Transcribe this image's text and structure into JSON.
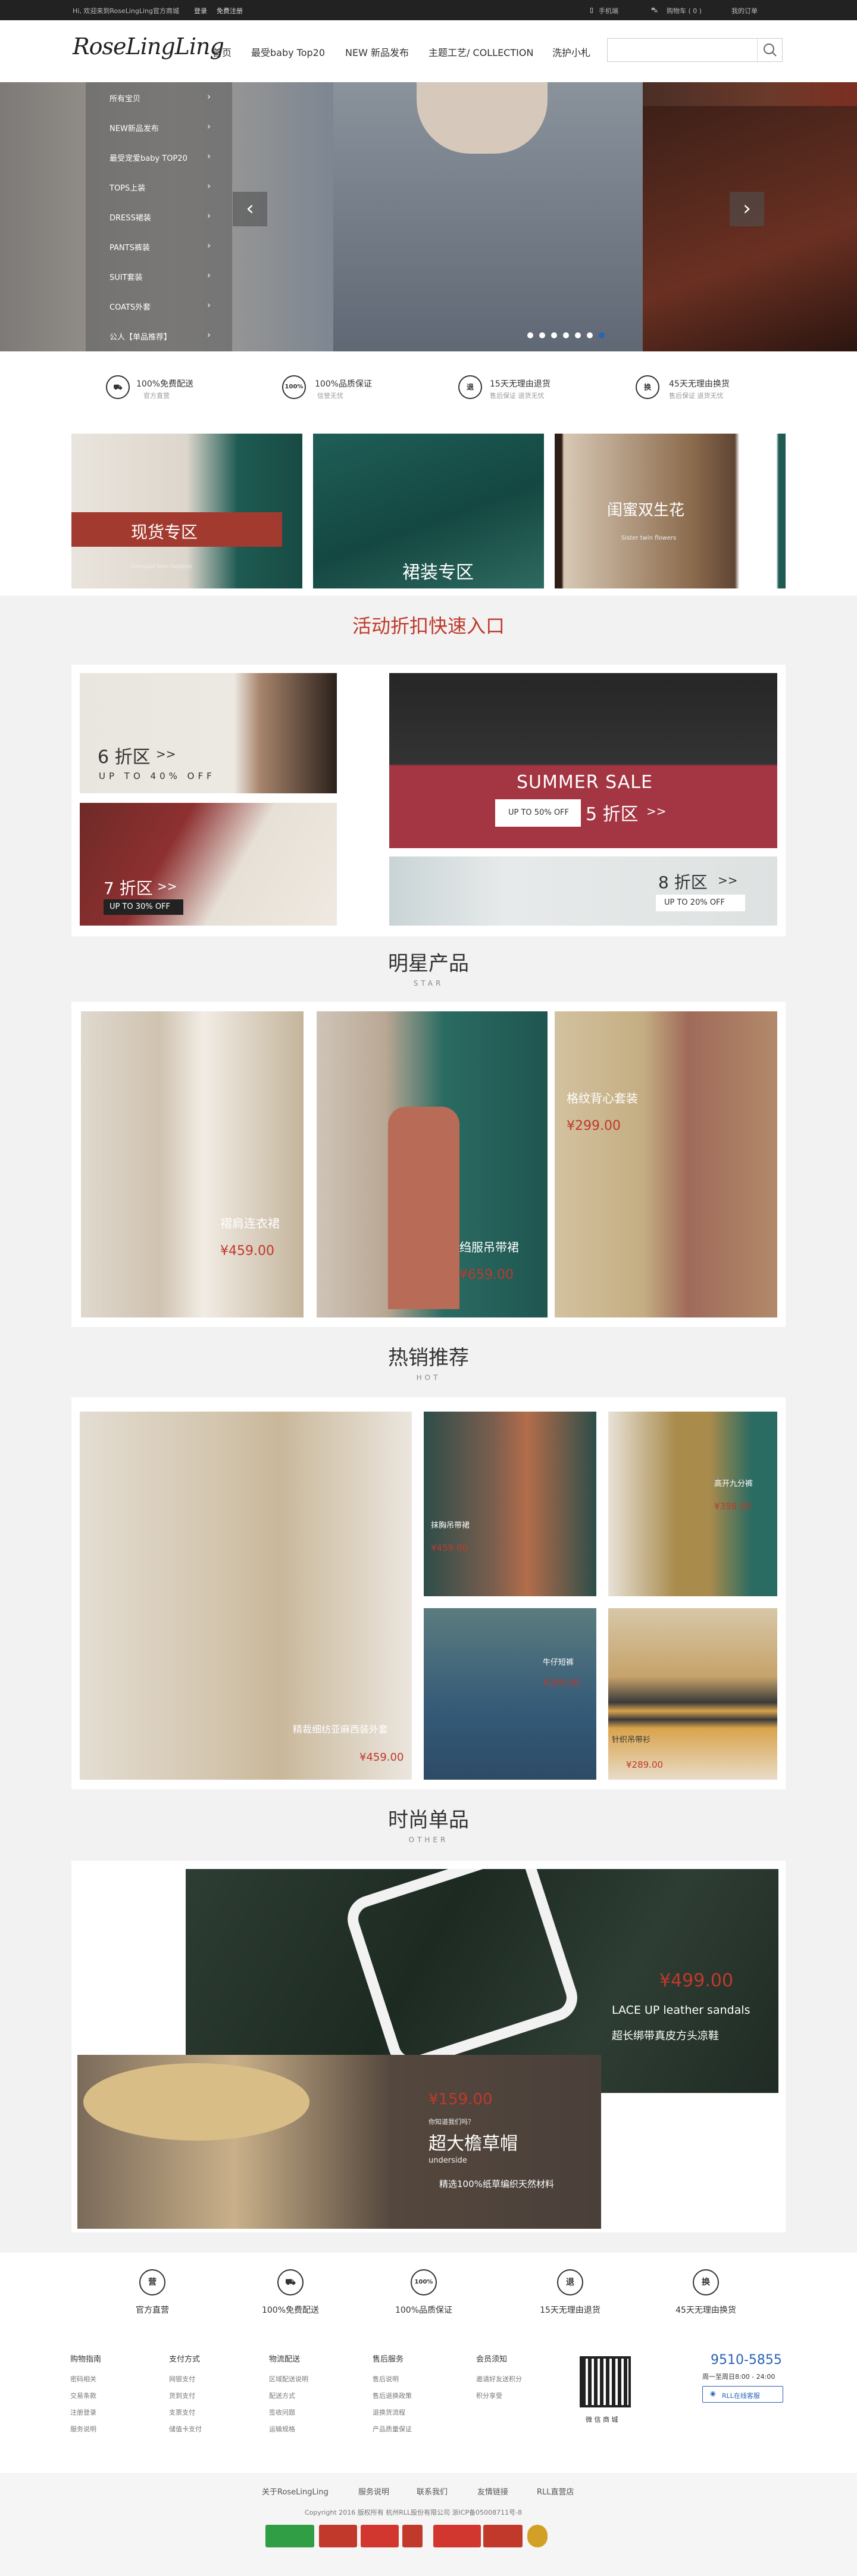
{
  "topbar": {
    "welcome": "Hi, 欢迎来到RoseLingLing官方商城",
    "login": "登录",
    "register": "免费注册",
    "mobile": "手机端",
    "cart": "购物车 ( 0 )",
    "orders": "我的订单"
  },
  "logo": "RoseLingLing",
  "nav": [
    "首页",
    "最受baby Top20",
    "NEW 新品发布",
    "主题工艺/ COLLECTION",
    "洗护小札"
  ],
  "search": {
    "placeholder": ""
  },
  "side_menu": [
    "所有宝贝",
    "NEW新品发布",
    "最受宠爱baby TOP20",
    "TOPS上装",
    "DRESS裙装",
    "PANTS裤装",
    "SUIT套装",
    "COATS外套",
    "公人【单品推荐】"
  ],
  "banner": {
    "prev": "‹",
    "next": "›"
  },
  "services": [
    {
      "icon": "truck-icon",
      "mark": "⛟",
      "title": "100%免费配送",
      "sub": "官方直营"
    },
    {
      "icon": "quality-icon",
      "mark": "100%",
      "title": "100%品质保证",
      "sub": "信誉无忧"
    },
    {
      "icon": "return-icon",
      "mark": "退",
      "title": "15天无理由退货",
      "sub": "售后保证 退货无忧"
    },
    {
      "icon": "exchange-icon",
      "mark": "换",
      "title": "45天无理由换货",
      "sub": "售后保证 退货无忧"
    }
  ],
  "categories": {
    "stock": "现货专区",
    "stock_sub": "Unusual bon-fashion",
    "skirts": "裙装专区",
    "flowers": "闺蜜双生花",
    "flowers_sub": "Sister twin flowers"
  },
  "discount": {
    "title": "活动折扣快速入口",
    "d6": "6 折区",
    "d6_arrow": ">>",
    "d6_sub": "UP TO 40% OFF",
    "summer": "SUMMER SALE",
    "d5_btn": "UP TO 50% OFF",
    "d5": "5 折区",
    "d5_arrow": ">>",
    "d7": "7 折区",
    "d7_arrow": ">>",
    "d7_btn": "UP TO 30% OFF",
    "d8": "8 折区",
    "d8_arrow": ">>",
    "d8_btn": "UP TO 20% OFF"
  },
  "star": {
    "title": "明星产品",
    "sub": "STAR",
    "items": [
      {
        "name": "褶肩连衣裙",
        "price": "¥459.00"
      },
      {
        "name": "绉服吊带裙",
        "price": "¥659.00"
      },
      {
        "name": "格纹背心套装",
        "price": "¥299.00"
      }
    ]
  },
  "hot": {
    "title": "热销推荐",
    "sub": "HOT",
    "items": [
      {
        "name": "精裁细纺亚麻西装外套",
        "price": "¥459.00"
      },
      {
        "name": "抹胸吊带裙",
        "price": "¥459.00"
      },
      {
        "name": "高开九分裤",
        "price": "¥398.00"
      },
      {
        "name": "牛仔短裤",
        "price": "¥289.00"
      },
      {
        "name": "针织吊带衫",
        "price": "¥289.00"
      }
    ]
  },
  "other": {
    "title": "时尚单品",
    "sub": "OTHER",
    "sandal_price": "¥499.00",
    "sandal_en": "LACE UP leather sandals",
    "sandal_cn": "超长绑带真皮方头凉鞋",
    "hat_price": "¥159.00",
    "hat_small": "你知道我们吗？",
    "hat_title": "超大檐草帽",
    "hat_en": "underside",
    "hat_desc": "精选100%纸草编织天然材料"
  },
  "footer_services": [
    {
      "icon": "official-icon",
      "mark": "营",
      "label": "官方直营"
    },
    {
      "icon": "truck-icon",
      "mark": "⛟",
      "label": "100%免费配送"
    },
    {
      "icon": "quality-icon",
      "mark": "100%",
      "label": "100%品质保证"
    },
    {
      "icon": "return-icon",
      "mark": "退",
      "label": "15天无理由退货"
    },
    {
      "icon": "exchange-icon",
      "mark": "换",
      "label": "45天无理由换货"
    }
  ],
  "footer_cols": [
    {
      "title": "购物指南",
      "items": [
        "密码相关",
        "交易条款",
        "注册登录",
        "服务说明"
      ]
    },
    {
      "title": "支付方式",
      "items": [
        "网银支付",
        "货到支付",
        "支票支付",
        "储值卡支付"
      ]
    },
    {
      "title": "物流配送",
      "items": [
        "区域配送说明",
        "配送方式",
        "签收问题",
        "运输规格"
      ]
    },
    {
      "title": "售后服务",
      "items": [
        "售后说明",
        "售后退换政策",
        "退换货流程",
        "产品质量保证"
      ]
    },
    {
      "title": "会员须知",
      "items": [
        "邀请好友送积分",
        "积分享受"
      ]
    }
  ],
  "qr_label": "微 信 商 城",
  "hotline": "9510-5855",
  "hours": "周一至周日8:00 - 24:00",
  "online": "RLL在线客服",
  "bottom_links": [
    "关于RoseLingLing",
    "服务说明",
    "联系我们",
    "友情链接",
    "RLL直营店"
  ],
  "copyright": "Copyright 2016 版权所有 杭州RLL股份有限公司 浙ICP备05008711号-8"
}
